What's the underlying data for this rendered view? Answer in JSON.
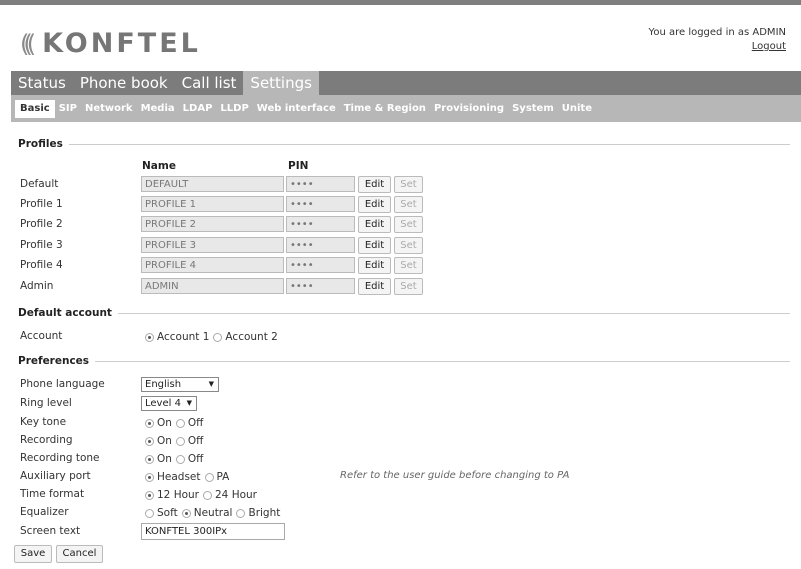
{
  "header": {
    "logo_waves": "(((",
    "brand": "KONFTEL",
    "login_text": "You are logged in as ADMIN",
    "logout": "Logout"
  },
  "main_tabs": [
    "Status",
    "Phone book",
    "Call list",
    "Settings"
  ],
  "main_tab_active": "Settings",
  "sub_tabs": [
    "Basic",
    "SIP",
    "Network",
    "Media",
    "LDAP",
    "LLDP",
    "Web interface",
    "Time & Region",
    "Provisioning",
    "System",
    "Unite"
  ],
  "sub_tab_active": "Basic",
  "profiles": {
    "title": "Profiles",
    "col_name": "Name",
    "col_pin": "PIN",
    "edit_label": "Edit",
    "set_label": "Set",
    "rows": [
      {
        "label": "Default",
        "name": "DEFAULT",
        "pin": "••••"
      },
      {
        "label": "Profile 1",
        "name": "PROFILE 1",
        "pin": "••••"
      },
      {
        "label": "Profile 2",
        "name": "PROFILE 2",
        "pin": "••••"
      },
      {
        "label": "Profile 3",
        "name": "PROFILE 3",
        "pin": "••••"
      },
      {
        "label": "Profile 4",
        "name": "PROFILE 4",
        "pin": "••••"
      },
      {
        "label": "Admin",
        "name": "ADMIN",
        "pin": "••••"
      }
    ]
  },
  "default_account": {
    "title": "Default account",
    "label": "Account",
    "options": [
      "Account 1",
      "Account 2"
    ],
    "selected": 0
  },
  "preferences": {
    "title": "Preferences",
    "phone_language": {
      "label": "Phone language",
      "value": "English"
    },
    "ring_level": {
      "label": "Ring level",
      "value": "Level 4"
    },
    "key_tone": {
      "label": "Key tone",
      "options": [
        "On",
        "Off"
      ],
      "selected": 0
    },
    "recording": {
      "label": "Recording",
      "options": [
        "On",
        "Off"
      ],
      "selected": 0
    },
    "recording_tone": {
      "label": "Recording tone",
      "options": [
        "On",
        "Off"
      ],
      "selected": 0
    },
    "auxiliary_port": {
      "label": "Auxiliary port",
      "options": [
        "Headset",
        "PA"
      ],
      "selected": 0,
      "note": "Refer to the user guide before changing to PA"
    },
    "time_format": {
      "label": "Time format",
      "options": [
        "12 Hour",
        "24 Hour"
      ],
      "selected": 0
    },
    "equalizer": {
      "label": "Equalizer",
      "options": [
        "Soft",
        "Neutral",
        "Bright"
      ],
      "selected": 1
    },
    "screen_text": {
      "label": "Screen text",
      "value": "KONFTEL 300IPx"
    }
  },
  "actions": {
    "save": "Save",
    "cancel": "Cancel"
  }
}
